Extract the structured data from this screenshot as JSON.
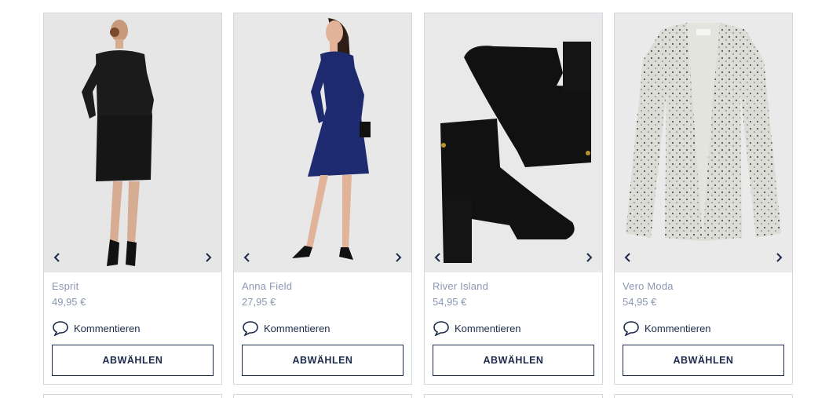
{
  "products": [
    {
      "brand": "Esprit",
      "price": "49,95 €",
      "comment_label": "Kommentieren",
      "action_label": "ABWÄHLEN",
      "image": "black-dress-back-view"
    },
    {
      "brand": "Anna Field",
      "price": "27,95 €",
      "comment_label": "Kommentieren",
      "action_label": "ABWÄHLEN",
      "image": "navy-wrap-dress"
    },
    {
      "brand": "River Island",
      "price": "54,95 €",
      "comment_label": "Kommentieren",
      "action_label": "ABWÄHLEN",
      "image": "black-suede-ankle-boots"
    },
    {
      "brand": "Vero Moda",
      "price": "54,95 €",
      "comment_label": "Kommentieren",
      "action_label": "ABWÄHLEN",
      "image": "speckled-knit-cardigan"
    }
  ],
  "icons": {
    "prev": "chevron-left-icon",
    "next": "chevron-right-icon",
    "comment": "speech-bubble-icon"
  },
  "colors": {
    "text_primary": "#1b2a4a",
    "text_muted": "#8a97b2",
    "card_border": "#d3d8e0",
    "image_bg": "#e7e7e7"
  }
}
